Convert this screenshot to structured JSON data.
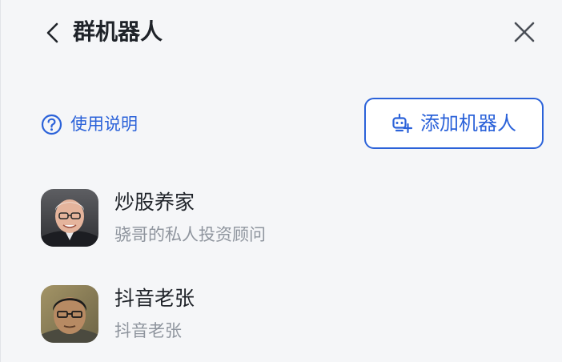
{
  "header": {
    "title": "群机器人",
    "back_icon": "chevron-left-icon",
    "close_icon": "close-icon"
  },
  "toolbar": {
    "help_label": "使用说明",
    "help_icon": "question-circle-icon",
    "add_bot_label": "添加机器人",
    "add_bot_icon": "robot-add-icon"
  },
  "bots": [
    {
      "name": "炒股养家",
      "description": "骁哥的私人投资顾问",
      "avatar": "avatar-photo"
    },
    {
      "name": "抖音老张",
      "description": "抖音老张",
      "avatar": "avatar-photo"
    }
  ],
  "colors": {
    "accent": "#2b62d9",
    "title_text": "#1f2329",
    "secondary_text": "#8f959e",
    "background": "#f5f6f8"
  }
}
